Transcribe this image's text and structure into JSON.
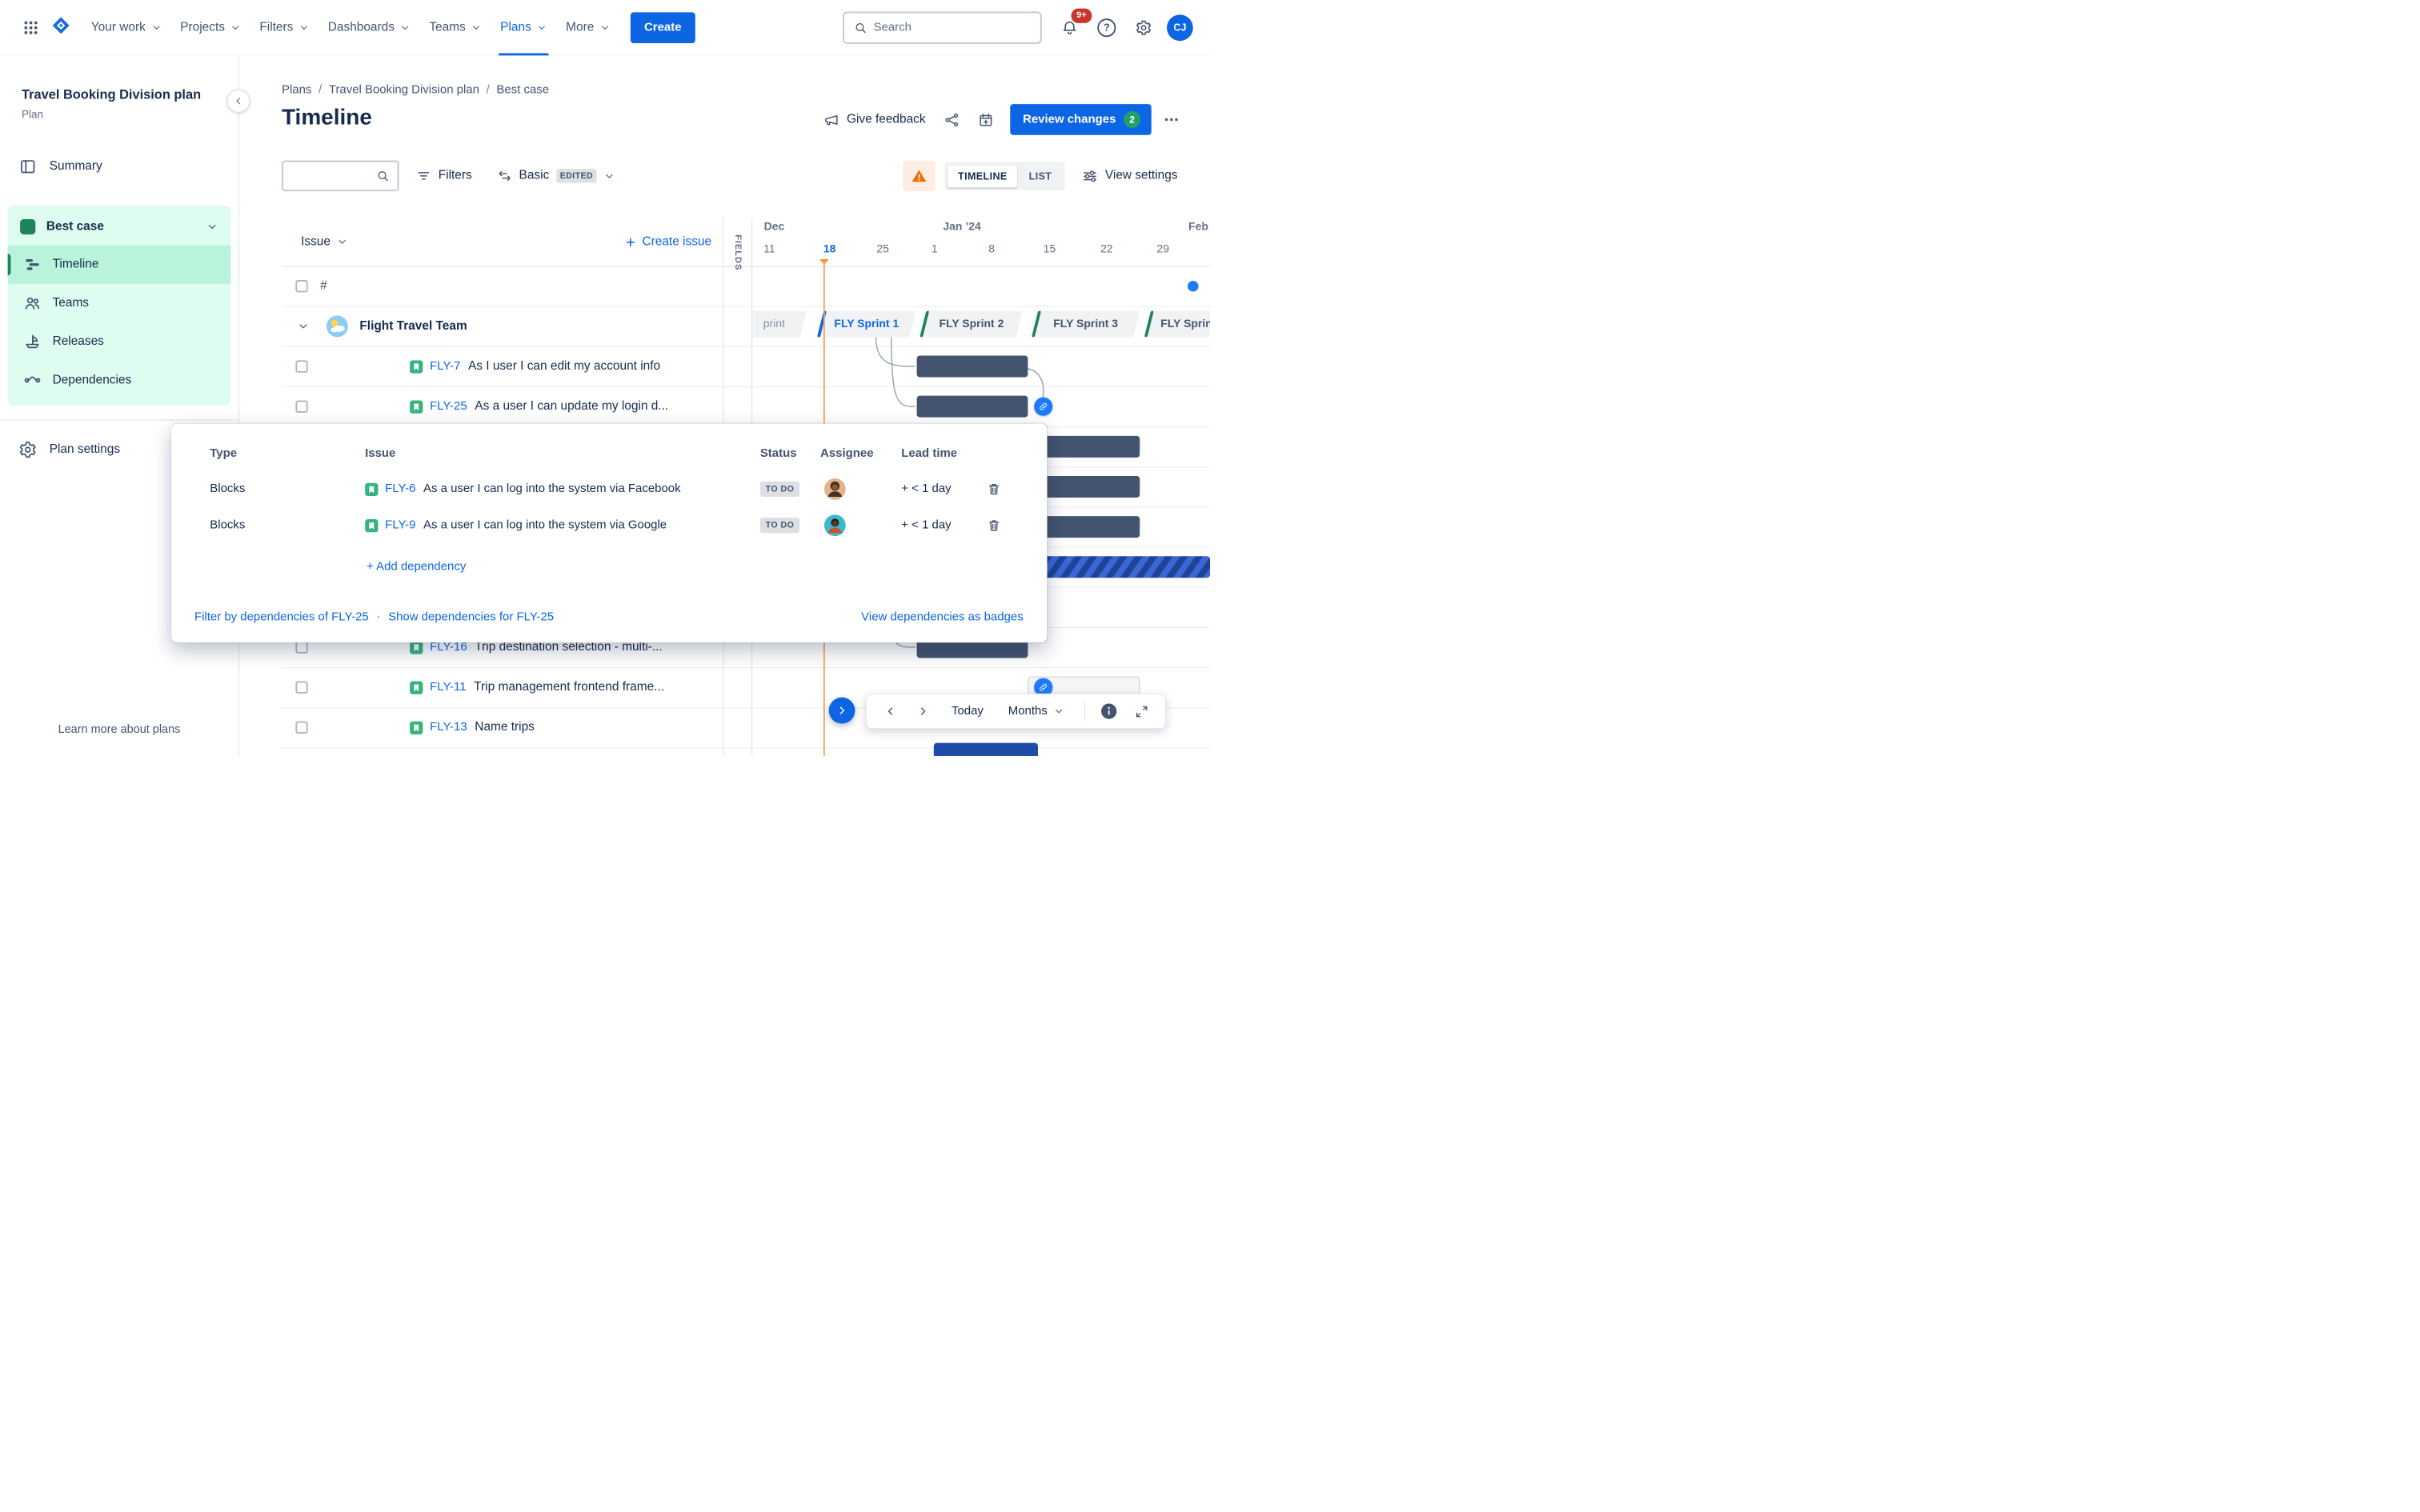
{
  "topnav": {
    "items": [
      {
        "label": "Your work"
      },
      {
        "label": "Projects"
      },
      {
        "label": "Filters"
      },
      {
        "label": "Dashboards"
      },
      {
        "label": "Teams"
      },
      {
        "label": "Plans"
      },
      {
        "label": "More"
      }
    ],
    "create_label": "Create",
    "search_placeholder": "Search",
    "notifications_badge": "9+",
    "avatar_initials": "CJ"
  },
  "sidebar": {
    "plan_title": "Travel Booking Division plan",
    "plan_type": "Plan",
    "summary": "Summary",
    "scenario": {
      "label": "Best case",
      "items": [
        {
          "label": "Timeline"
        },
        {
          "label": "Teams"
        },
        {
          "label": "Releases"
        },
        {
          "label": "Dependencies"
        }
      ]
    },
    "plan_settings": "Plan settings",
    "learn_more": "Learn more about plans"
  },
  "header": {
    "breadcrumb": [
      "Plans",
      "Travel Booking Division plan",
      "Best case"
    ],
    "breadcrumb_separator": "/",
    "title": "Timeline",
    "give_feedback": "Give feedback",
    "review_changes": "Review changes",
    "review_count": "2"
  },
  "toolbar": {
    "filters": "Filters",
    "view_name": "Basic",
    "view_badge": "EDITED",
    "timeline": "TIMELINE",
    "list": "LIST",
    "view_settings": "View settings"
  },
  "issues": {
    "column_header": "Issue",
    "create_issue": "Create issue",
    "fields": "FIELDS",
    "hash": "#",
    "team": "Flight Travel Team",
    "rows": [
      {
        "key": "FLY-7",
        "summary": "As I user I can edit my account info"
      },
      {
        "key": "FLY-25",
        "summary": "As a user I can update my login d..."
      },
      {
        "key": "FLY-16",
        "summary": "Trip destination selection - multi-..."
      },
      {
        "key": "FLY-11",
        "summary": "Trip management frontend frame..."
      },
      {
        "key": "FLY-13",
        "summary": "Name trips"
      }
    ]
  },
  "timeline": {
    "months": [
      {
        "label": "Dec"
      },
      {
        "label": "Jan ’24"
      },
      {
        "label": "Feb"
      }
    ],
    "dates": [
      "11",
      "18",
      "25",
      "1",
      "8",
      "15",
      "22",
      "29"
    ],
    "sprints": [
      {
        "label": "print"
      },
      {
        "label": "FLY Sprint 1"
      },
      {
        "label": "FLY Sprint 2"
      },
      {
        "label": "FLY Sprint 3"
      },
      {
        "label": "FLY Sprin"
      }
    ]
  },
  "dependencies_popup": {
    "columns": [
      "Type",
      "Issue",
      "Status",
      "Assignee",
      "Lead time"
    ],
    "rows": [
      {
        "type": "Blocks",
        "key": "FLY-6",
        "summary": "As a user I can log into the system via Facebook",
        "status": "TO DO",
        "lead_time": "+ < 1 day"
      },
      {
        "type": "Blocks",
        "key": "FLY-9",
        "summary": "As a user I can log into the system via Google",
        "status": "TO DO",
        "lead_time": "+ < 1 day"
      }
    ],
    "add_dependency": "+ Add dependency",
    "filter_by": "Filter by dependencies of FLY-25",
    "separator": "·",
    "show_for": "Show dependencies for FLY-25",
    "view_as_badges": "View dependencies as badges"
  },
  "bottombar": {
    "today": "Today",
    "zoom": "Months"
  }
}
